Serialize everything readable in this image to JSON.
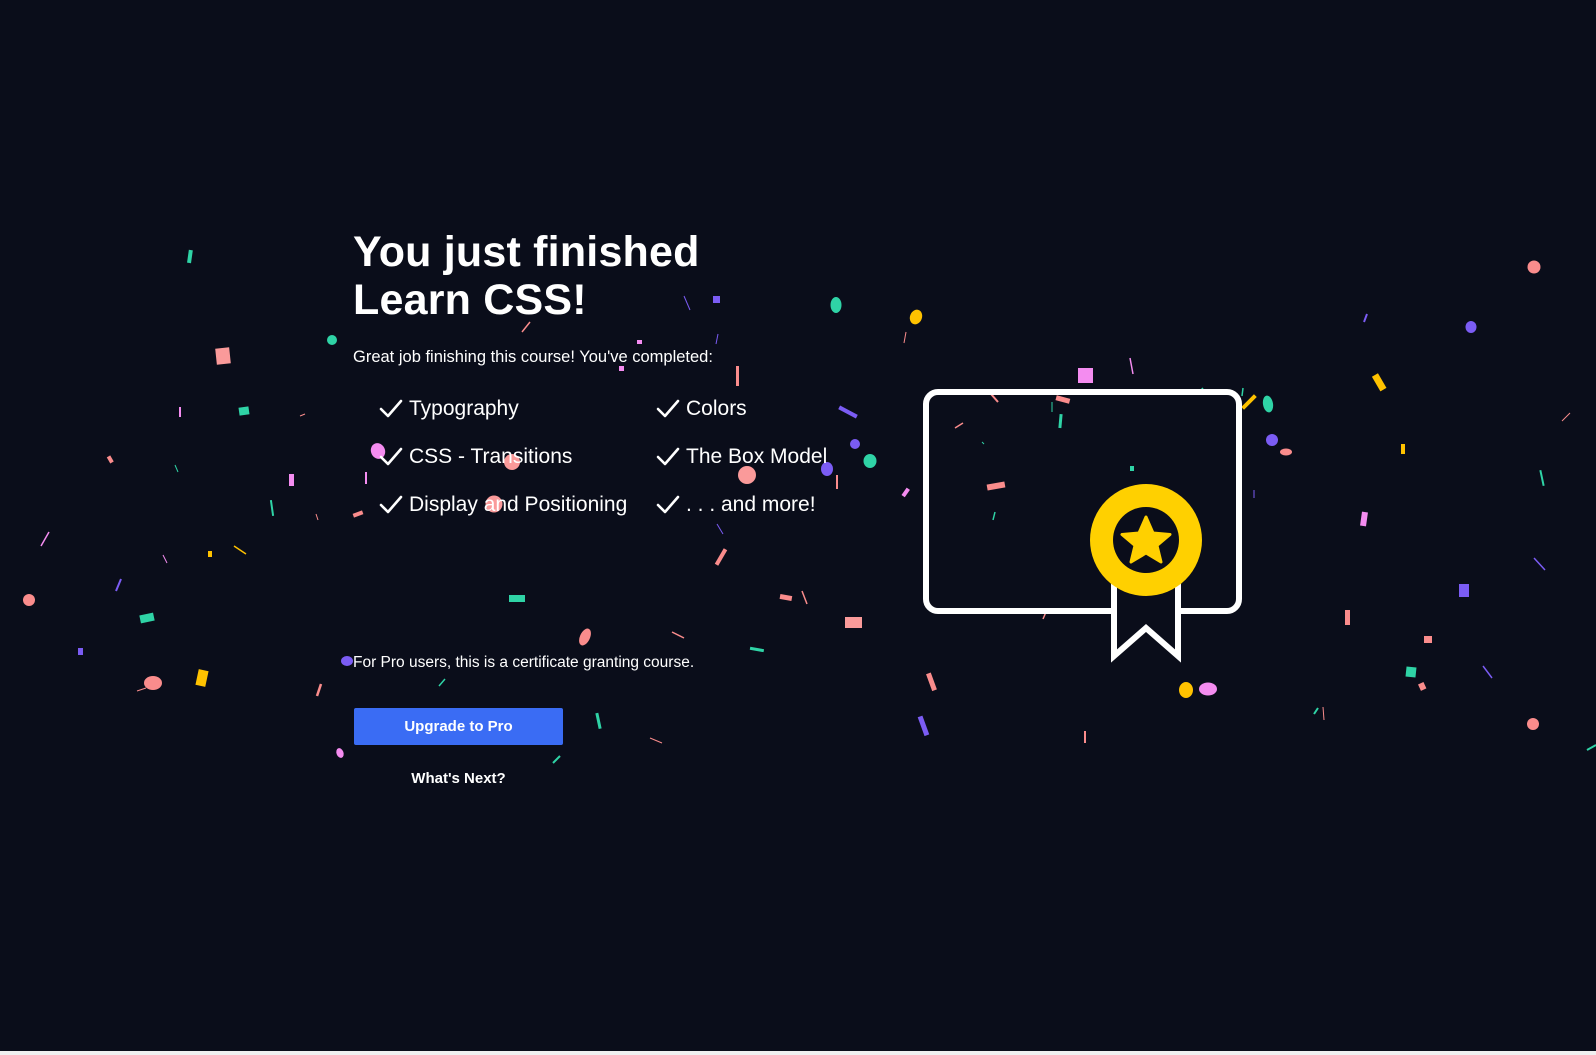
{
  "completion": {
    "headline_line1": "You just finished",
    "headline_line2": "Learn CSS!",
    "subtitle": "Great job finishing this course! You've completed:"
  },
  "topics": [
    {
      "label": "Typography"
    },
    {
      "label": "Colors"
    },
    {
      "label": "CSS - Transitions"
    },
    {
      "label": "The Box Model"
    },
    {
      "label": "Display and Positioning"
    },
    {
      "label": ". . . and more!"
    }
  ],
  "pro_note": "For Pro users, this is a certificate granting course.",
  "actions": {
    "upgrade_label": "Upgrade to Pro",
    "whats_next_label": "What's Next?"
  },
  "icons": {
    "checkmark": "checkmark-icon",
    "certificate": "certificate-icon",
    "award_ribbon": "award-ribbon-icon",
    "star": "star-icon"
  },
  "colors": {
    "background": "#0a0d1a",
    "primary_button": "#3a6cf4",
    "award_gold": "#ffd000",
    "confetti": [
      "#2fd3a6",
      "#fa8c8c",
      "#7b5cf4",
      "#ffc200",
      "#f48cf0"
    ]
  }
}
